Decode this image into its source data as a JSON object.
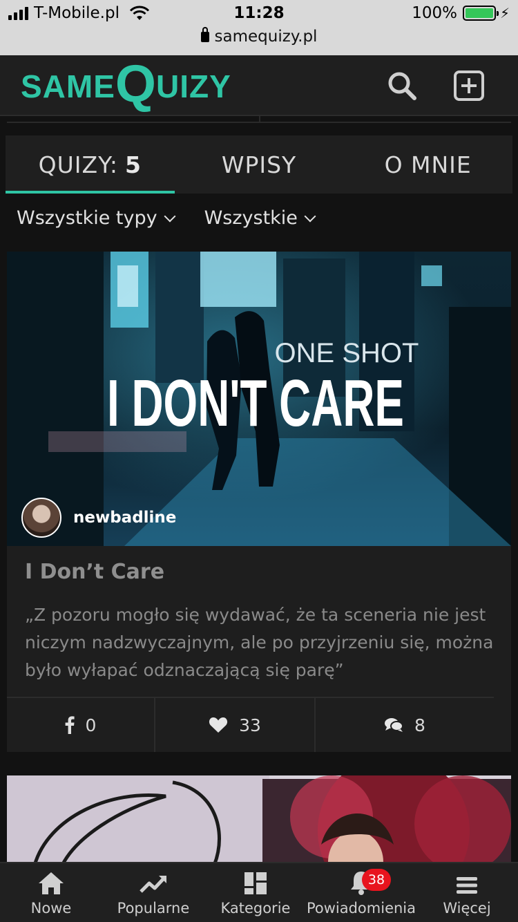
{
  "status_bar": {
    "carrier": "T-Mobile.pl",
    "time": "11:28",
    "battery_percent": "100%",
    "url": "samequizy.pl"
  },
  "header": {
    "logo_part1": "SAME",
    "logo_q": "Q",
    "logo_part2": "UIZY"
  },
  "tabs": [
    {
      "label": "QUIZY:",
      "count": "5",
      "active": true
    },
    {
      "label": "WPISY"
    },
    {
      "label": "O MNIE"
    }
  ],
  "filters": {
    "type": "Wszystkie typy",
    "scope": "Wszystkie"
  },
  "quiz_card": {
    "cover_kicker": "ONE SHOT",
    "cover_title": "I DON'T CARE",
    "author": "newbadline",
    "title": "I Don’t Care",
    "description": "„Z pozoru mogło się wydawać, że ta sceneria nie jest niczym nadzwyczajnym, ale po przyjrzeniu się, można było wyłapać odznaczającą się parę”",
    "shares": "0",
    "likes": "33",
    "comments": "8"
  },
  "bottom_nav": {
    "items": [
      {
        "label": "Nowe",
        "icon": "home-icon"
      },
      {
        "label": "Popularne",
        "icon": "trending-icon"
      },
      {
        "label": "Kategorie",
        "icon": "grid-icon"
      },
      {
        "label": "Powiadomienia",
        "icon": "bell-icon",
        "badge": "38"
      },
      {
        "label": "Więcej",
        "icon": "menu-icon"
      }
    ]
  },
  "colors": {
    "accent": "#2fc5a5",
    "background": "#121212",
    "card": "#1e1e1e",
    "badge": "#e8141e"
  }
}
